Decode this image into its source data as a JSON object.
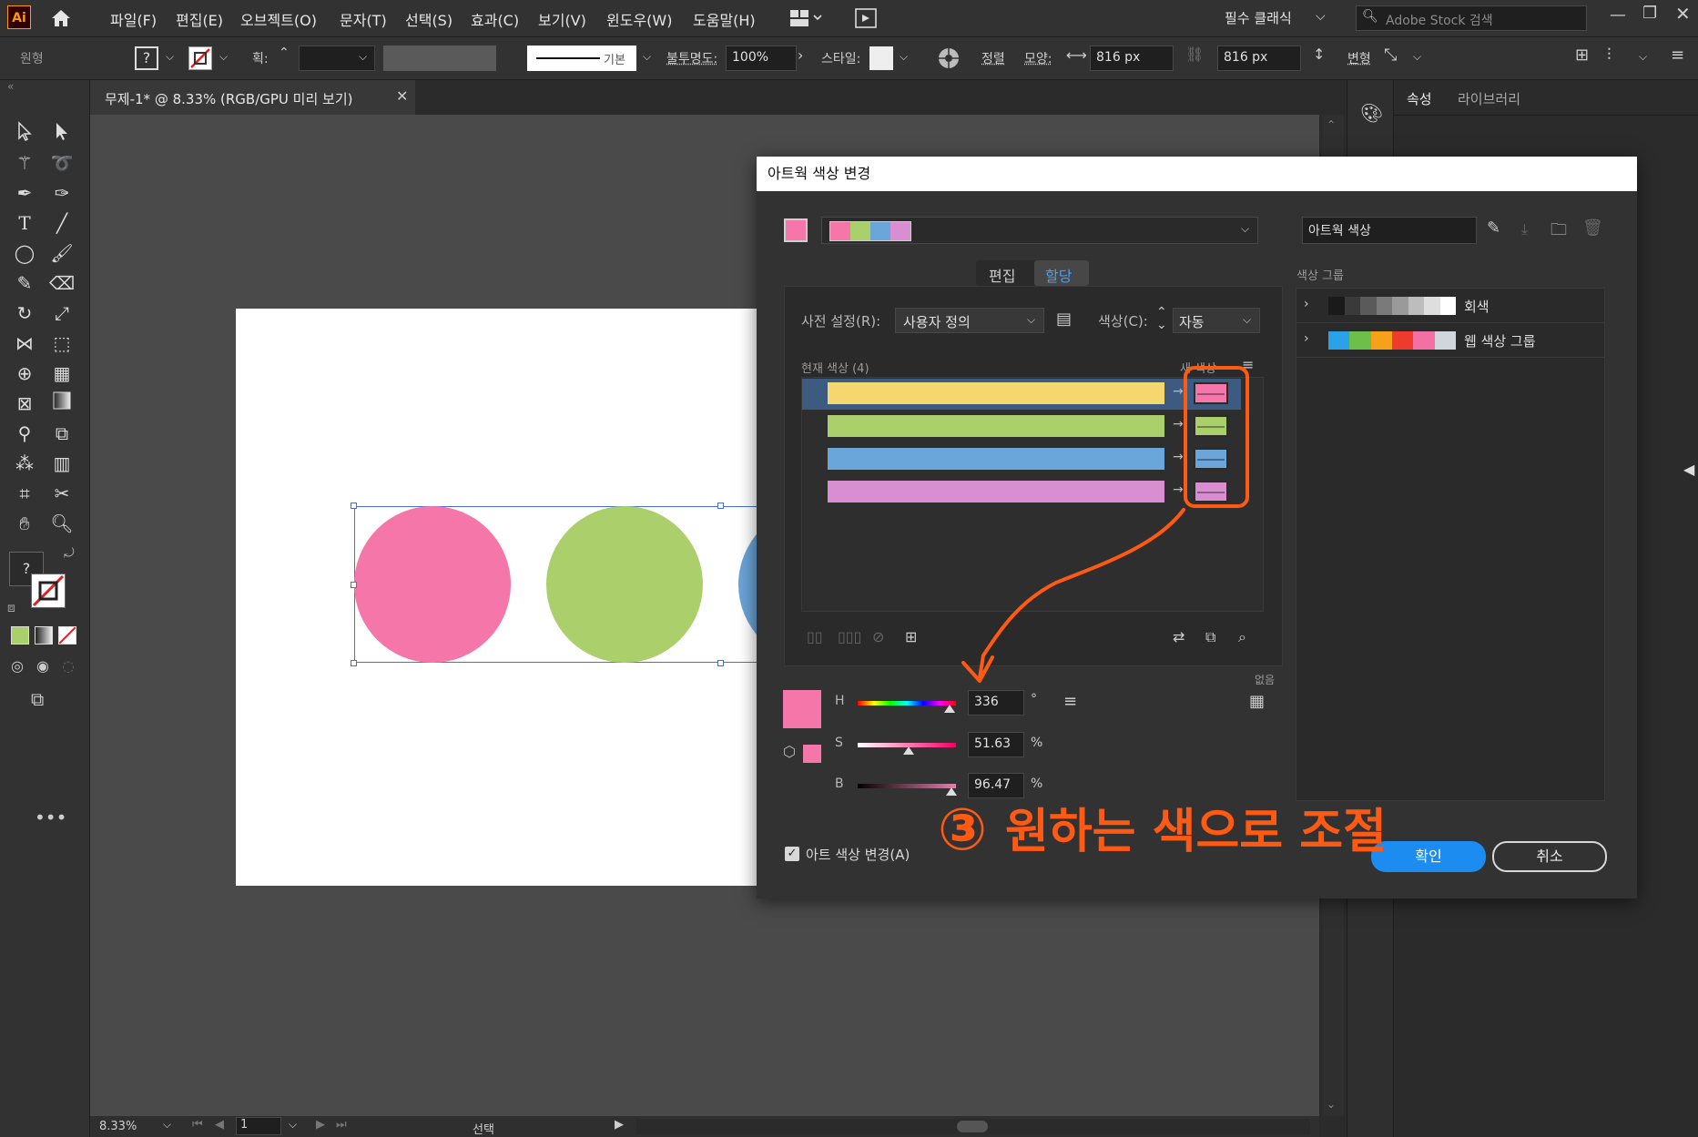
{
  "menubar": {
    "app_icon": "Ai",
    "items": [
      "파일(F)",
      "편집(E)",
      "오브젝트(O)",
      "문자(T)",
      "선택(S)",
      "효과(C)",
      "보기(V)",
      "윈도우(W)",
      "도움말(H)"
    ],
    "workspace": "필수 클래식",
    "stock_search_placeholder": "Adobe Stock 검색"
  },
  "controlbar": {
    "selection_type": "원형",
    "stroke_label": "획:",
    "stroke_profile": "기본",
    "opacity_label": "불투명도:",
    "opacity_value": "100%",
    "style_label": "스타일:",
    "align_label": "정렬",
    "shape_label": "모양:",
    "width_value": "816 px",
    "height_value": "816 px",
    "transform_label": "변형"
  },
  "document": {
    "tab_title": "무제-1* @ 8.33% (RGB/GPU 미리 보기)",
    "zoom": "8.33%",
    "artboard_number": "1",
    "status_label": "선택"
  },
  "artwork": {
    "circles": [
      {
        "name": "pink-circle",
        "color": "#f576a9"
      },
      {
        "name": "green-circle",
        "color": "#aacf6b"
      },
      {
        "name": "blue-circle",
        "color": "#6aa3d6"
      }
    ]
  },
  "right_panel": {
    "tabs": [
      "속성",
      "라이브러리"
    ]
  },
  "dialog": {
    "title": "아트웍 색상 변경",
    "group_name": "아트웍 색상",
    "tabs": [
      "편집",
      "할당"
    ],
    "active_tab": "할당",
    "preset_label": "사전 설정(R):",
    "preset_value": "사용자 정의",
    "colors_label": "색상(C):",
    "colors_value": "자동",
    "current_colors_label": "현재 색상 (4)",
    "new_label": "새 색상",
    "current_colors": [
      "#f5d770",
      "#a9d06a",
      "#6aa6da",
      "#d88ed0"
    ],
    "new_colors": [
      "#f576a9",
      "#a9d06a",
      "#6aa6da",
      "#d88ed0"
    ],
    "group_swatch_colors": [
      "#f576a9",
      "#a9d06a",
      "#6aa6da",
      "#d88ed0"
    ],
    "color_groups_label": "색상 그룹",
    "color_groups": [
      {
        "name": "회색",
        "colors": [
          "#1a1a1a",
          "#3a3a3a",
          "#5a5a5a",
          "#7a7a7a",
          "#9a9a9a",
          "#bdbdbd",
          "#dedede",
          "#ffffff"
        ]
      },
      {
        "name": "웹 색상 그룹",
        "colors": [
          "#2aa2e8",
          "#6cc04a",
          "#f7a11a",
          "#ef3b2d",
          "#f46fa4",
          "#d0d6dc"
        ]
      }
    ],
    "hsb": {
      "h_label": "H",
      "h_value": "336",
      "h_unit": "°",
      "s_label": "S",
      "s_value": "51.63",
      "s_unit": "%",
      "b_label": "B",
      "b_value": "96.47",
      "b_unit": "%"
    },
    "none_label": "없음",
    "recolor_checkbox_label": "아트 색상 변경(A)",
    "recolor_checked": true,
    "ok_label": "확인",
    "cancel_label": "취소",
    "selected_color": "#f576a9"
  },
  "annotation": {
    "number": "③",
    "text": "원하는 색으로 조절"
  }
}
